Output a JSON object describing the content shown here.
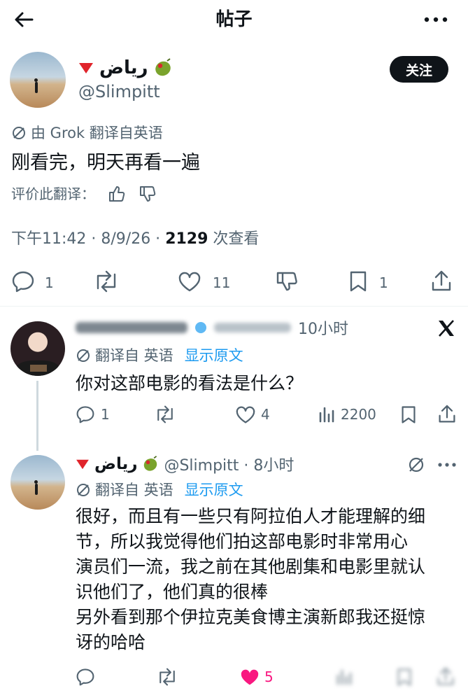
{
  "header": {
    "title": "帖子"
  },
  "main_post": {
    "display_name": "رياض",
    "handle": "@Slimpitt",
    "follow_label": "关注",
    "translation_note": "由 Grok 翻译自英语",
    "text": "刚看完，明天再看一遍",
    "rate_translation": "评价此翻译：",
    "meta": {
      "time": "下午11:42 · 8/9/26 · ",
      "views": "2129",
      "views_suffix": " 次查看"
    },
    "actions": {
      "replies": "1",
      "likes": "11",
      "bookmarks": "1"
    }
  },
  "reply1": {
    "time": "10小时",
    "translation_prefix": "翻译自 英语",
    "show_original": "显示原文",
    "text": "你对这部电影的看法是什么？",
    "actions": {
      "replies": "1",
      "likes": "4",
      "views": "2200"
    }
  },
  "reply2": {
    "display_name": "رياض",
    "handle_time": "@Slimpitt · 8小时",
    "translation_prefix": "翻译自 英语",
    "show_original": "显示原文",
    "lines": [
      "很好，而且有一些只有阿拉伯人才能理解的细",
      "节，所以我觉得他们拍这部电影时非常用心",
      "演员们一流，我之前在其他剧集和电影里就认",
      "识他们了，他们真的很棒",
      "另外看到那个伊拉克美食博主演新郎我还挺惊",
      "讶的哈哈"
    ],
    "actions": {
      "likes": "5"
    }
  },
  "colors": {
    "accent": "#1d9bf0",
    "like": "#f91880",
    "text": "#0f1419",
    "muted": "#536471"
  }
}
